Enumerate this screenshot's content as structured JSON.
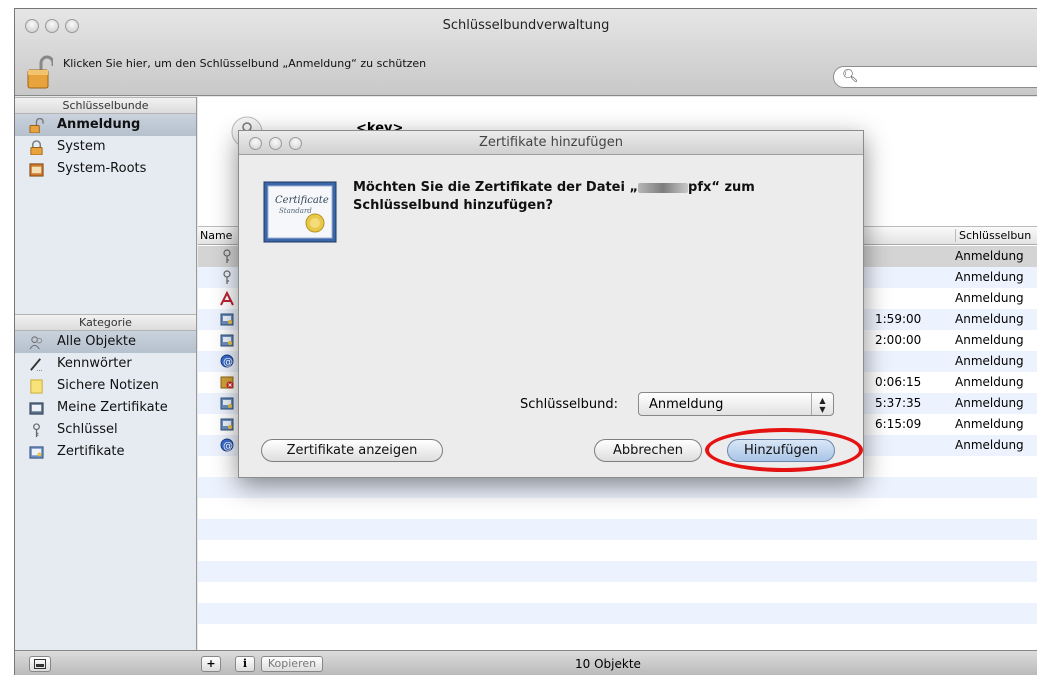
{
  "window": {
    "title": "Schlüsselbundverwaltung",
    "lock_message": "Klicken Sie hier, um den Schlüsselbund „Anmeldung“ zu schützen",
    "search_placeholder": ""
  },
  "sidebar": {
    "keychains_header": "Schlüsselbunde",
    "keychains": [
      {
        "label": "Anmeldung",
        "icon": "open-lock-icon",
        "selected": true
      },
      {
        "label": "System",
        "icon": "lock-icon",
        "selected": false
      },
      {
        "label": "System-Roots",
        "icon": "cabinet-icon",
        "selected": false
      }
    ],
    "category_header": "Kategorie",
    "categories": [
      {
        "label": "Alle Objekte",
        "icon": "people-icon",
        "selected": true
      },
      {
        "label": "Kennwörter",
        "icon": "pencil-icon",
        "selected": false
      },
      {
        "label": "Sichere Notizen",
        "icon": "note-icon",
        "selected": false
      },
      {
        "label": "Meine Zertifikate",
        "icon": "my-certificate-icon",
        "selected": false
      },
      {
        "label": "Schlüssel",
        "icon": "key-icon",
        "selected": false
      },
      {
        "label": "Zertifikate",
        "icon": "certificate-icon",
        "selected": false
      }
    ]
  },
  "info": {
    "name": "<key>"
  },
  "table": {
    "col_name": "Name",
    "col_keychain": "Schlüsselbun",
    "rows": [
      {
        "icon": "key-icon",
        "time": "",
        "keychain": "Anmeldung"
      },
      {
        "icon": "key-icon",
        "time": "",
        "keychain": "Anmeldung"
      },
      {
        "icon": "app-icon",
        "time": "",
        "keychain": "Anmeldung"
      },
      {
        "icon": "certificate-icon",
        "time": "1:59:00",
        "keychain": "Anmeldung"
      },
      {
        "icon": "certificate-icon",
        "time": "2:00:00",
        "keychain": "Anmeldung"
      },
      {
        "icon": "at-icon",
        "time": "",
        "keychain": "Anmeldung"
      },
      {
        "icon": "invalid-certificate-icon",
        "time": "0:06:15",
        "keychain": "Anmeldung"
      },
      {
        "icon": "certificate-icon",
        "time": "5:37:35",
        "keychain": "Anmeldung"
      },
      {
        "icon": "certificate-icon",
        "time": "6:15:09",
        "keychain": "Anmeldung"
      },
      {
        "icon": "at-icon",
        "time": "",
        "keychain": "Anmeldung"
      }
    ]
  },
  "bottom": {
    "add": "+",
    "info": "i",
    "copy": "Kopieren",
    "status": "10 Objekte"
  },
  "dialog": {
    "title": "Zertifikate hinzufügen",
    "message_1": "Möchten Sie die Zertifikate der Datei „",
    "message_2": "pfx“ zum",
    "message_3": "Schlüsselbund hinzufügen?",
    "keychain_label": "Schlüsselbund:",
    "keychain_value": "Anmeldung",
    "show_certificates": "Zertifikate anzeigen",
    "cancel": "Abbrechen",
    "add": "Hinzufügen"
  },
  "cert_badge": {
    "line1": "Certificate",
    "line2": "Standard"
  }
}
